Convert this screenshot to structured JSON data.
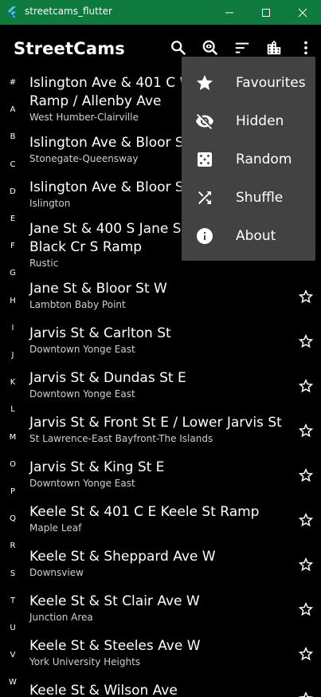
{
  "window": {
    "title": "streetcams_flutter",
    "controls": [
      "minimize",
      "maximize",
      "close"
    ]
  },
  "appbar": {
    "title": "StreetCams",
    "actions": [
      "search-icon",
      "hidden-search-icon",
      "sort-icon",
      "city-icon",
      "more-vert-icon"
    ]
  },
  "alpha_index": [
    "#",
    "A",
    "B",
    "C",
    "D",
    "E",
    "F",
    "G",
    "H",
    "I",
    "J",
    "K",
    "L",
    "M",
    "O",
    "P",
    "Q",
    "R",
    "S",
    "T",
    "U",
    "V",
    "W"
  ],
  "cameras": [
    {
      "name_line1": "Islington Ave & 401 C W",
      "name_line2": "Ramp / Allenby Ave",
      "area": "West Humber-Clairville"
    },
    {
      "name_line1": "Islington Ave & Bloor St W",
      "name_line2": "",
      "area": "Stonegate-Queensway"
    },
    {
      "name_line1": "Islington Ave & Bloor St W",
      "name_line2": "",
      "area": "Islington"
    },
    {
      "name_line1": "Jane St & 400 S Jane St Ramp /",
      "name_line2": "Black Cr S Ramp",
      "area": "Rustic"
    },
    {
      "name_line1": "Jane St & Bloor St W",
      "name_line2": "",
      "area": "Lambton Baby Point"
    },
    {
      "name_line1": "Jarvis St & Carlton St",
      "name_line2": "",
      "area": "Downtown Yonge East"
    },
    {
      "name_line1": "Jarvis St & Dundas St E",
      "name_line2": "",
      "area": "Downtown Yonge East"
    },
    {
      "name_line1": "Jarvis St & Front St E / Lower Jarvis St",
      "name_line2": "",
      "area": "St Lawrence-East Bayfront-The Islands"
    },
    {
      "name_line1": "Jarvis St & King St E",
      "name_line2": "",
      "area": "Downtown Yonge East"
    },
    {
      "name_line1": "Keele St & 401 C E Keele St Ramp",
      "name_line2": "",
      "area": "Maple Leaf"
    },
    {
      "name_line1": "Keele St & Sheppard Ave W",
      "name_line2": "",
      "area": "Downsview"
    },
    {
      "name_line1": "Keele St & St Clair Ave W",
      "name_line2": "",
      "area": "Junction Area"
    },
    {
      "name_line1": "Keele St & Steeles Ave W",
      "name_line2": "",
      "area": "York University Heights"
    },
    {
      "name_line1": "Keele St & Wilson Ave",
      "name_line2": "",
      "area": ""
    }
  ],
  "menu": {
    "items": [
      {
        "label": "Favourites",
        "icon": "star-icon"
      },
      {
        "label": "Hidden",
        "icon": "visibility-off-icon"
      },
      {
        "label": "Random",
        "icon": "casino-icon"
      },
      {
        "label": "Shuffle",
        "icon": "shuffle-icon"
      },
      {
        "label": "About",
        "icon": "info-icon"
      }
    ]
  },
  "colors": {
    "titlebar": "#0f7a3d",
    "background": "#000000",
    "menu": "#424242",
    "subtitle": "#cfcfcf"
  }
}
